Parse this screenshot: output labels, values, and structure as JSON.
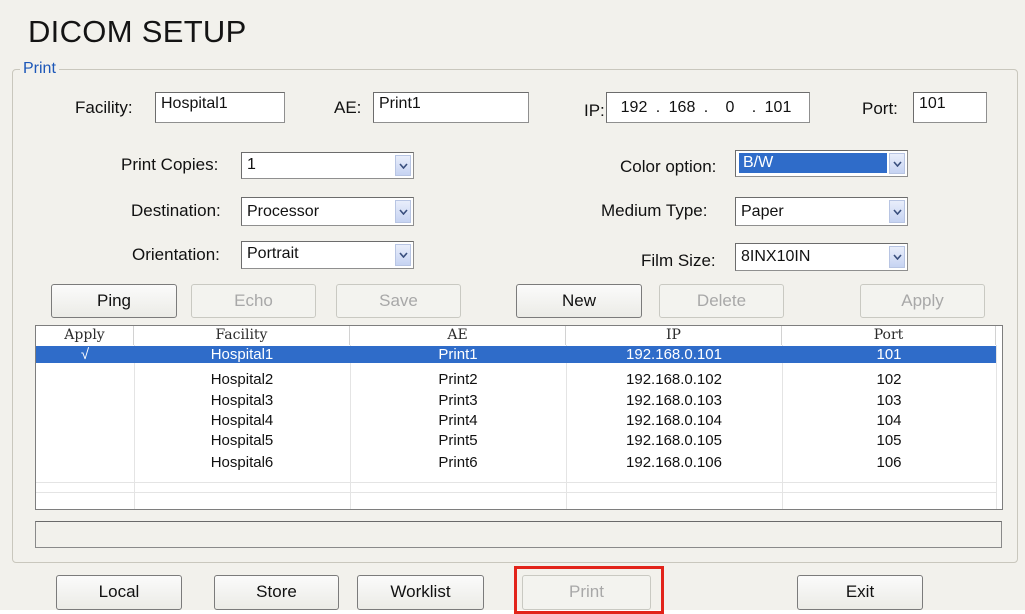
{
  "page": {
    "title": "DICOM SETUP",
    "group_label": "Print"
  },
  "form": {
    "facility": {
      "label": "Facility:",
      "value": "Hospital1"
    },
    "ae": {
      "label": "AE:",
      "value": "Print1"
    },
    "ip": {
      "label": "IP:",
      "octets": [
        "192",
        "168",
        "0",
        "101"
      ]
    },
    "port": {
      "label": "Port:",
      "value": "101"
    },
    "print_copies": {
      "label": "Print Copies:",
      "value": "1"
    },
    "destination": {
      "label": "Destination:",
      "value": "Processor"
    },
    "orientation": {
      "label": "Orientation:",
      "value": "Portrait"
    },
    "color_option": {
      "label": "Color option:",
      "value": "B/W"
    },
    "medium_type": {
      "label": "Medium Type:",
      "value": "Paper"
    },
    "film_size": {
      "label": "Film Size:",
      "value": "8INX10IN"
    }
  },
  "actions": {
    "ping": "Ping",
    "echo": "Echo",
    "save": "Save",
    "new": "New",
    "delete": "Delete",
    "apply": "Apply"
  },
  "table": {
    "columns": [
      "Apply",
      "Facility",
      "AE",
      "IP",
      "Port"
    ],
    "rows": [
      {
        "apply": "√",
        "facility": "Hospital1",
        "ae": "Print1",
        "ip": "192.168.0.101",
        "port": "101",
        "selected": true
      },
      {
        "apply": "",
        "facility": "Hospital2",
        "ae": "Print2",
        "ip": "192.168.0.102",
        "port": "102"
      },
      {
        "apply": "",
        "facility": "Hospital3",
        "ae": "Print3",
        "ip": "192.168.0.103",
        "port": "103"
      },
      {
        "apply": "",
        "facility": "Hospital4",
        "ae": "Print4",
        "ip": "192.168.0.104",
        "port": "104"
      },
      {
        "apply": "",
        "facility": "Hospital5",
        "ae": "Print5",
        "ip": "192.168.0.105",
        "port": "105"
      },
      {
        "apply": "",
        "facility": "Hospital6",
        "ae": "Print6",
        "ip": "192.168.0.106",
        "port": "106"
      }
    ]
  },
  "status_bar": {
    "text": ""
  },
  "bottom_nav": {
    "local": "Local",
    "store": "Store",
    "worklist": "Worklist",
    "print": "Print",
    "exit": "Exit"
  },
  "colors": {
    "selection": "#2f6cc9",
    "group_label": "#1c57b8",
    "highlight_box": "#e2231a",
    "disabled_text": "#a8a8a8"
  },
  "icons": {
    "dropdown": "chevron-down-icon",
    "checkmark": "check-icon"
  }
}
